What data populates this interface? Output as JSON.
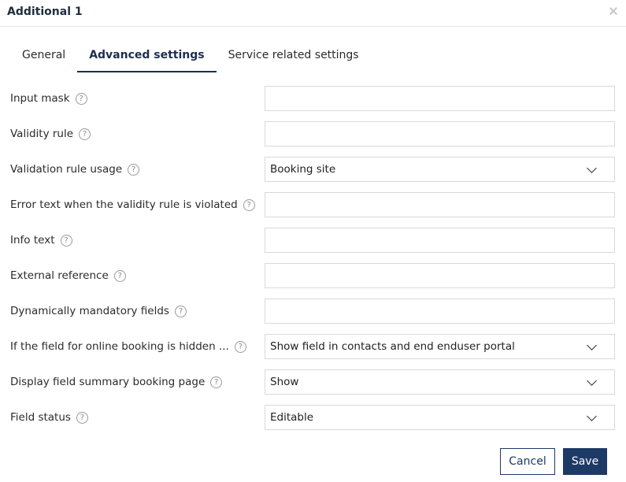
{
  "dialog": {
    "title": "Additional 1",
    "close_icon": "close-icon"
  },
  "tabs": [
    {
      "label": "General",
      "active": false
    },
    {
      "label": "Advanced settings",
      "active": true
    },
    {
      "label": "Service related settings",
      "active": false
    }
  ],
  "fields": [
    {
      "label": "Input mask",
      "type": "text",
      "value": ""
    },
    {
      "label": "Validity rule",
      "type": "text",
      "value": ""
    },
    {
      "label": "Validation rule usage",
      "type": "select",
      "value": "Booking site"
    },
    {
      "label": "Error text when the validity rule is violated",
      "type": "text",
      "value": ""
    },
    {
      "label": "Info text",
      "type": "text",
      "value": ""
    },
    {
      "label": "External reference",
      "type": "text",
      "value": ""
    },
    {
      "label": "Dynamically mandatory fields",
      "type": "text",
      "value": ""
    },
    {
      "label": "If the field for online booking is hidden ...",
      "type": "select",
      "value": "Show field in contacts and end enduser portal"
    },
    {
      "label": "Display field summary booking page",
      "type": "select",
      "value": "Show"
    },
    {
      "label": "Field status",
      "type": "select",
      "value": "Editable"
    }
  ],
  "help_symbol": "?",
  "buttons": {
    "cancel_label": "Cancel",
    "save_label": "Save"
  },
  "colors": {
    "accent": "#1d3a66",
    "border": "#d6d9de"
  }
}
